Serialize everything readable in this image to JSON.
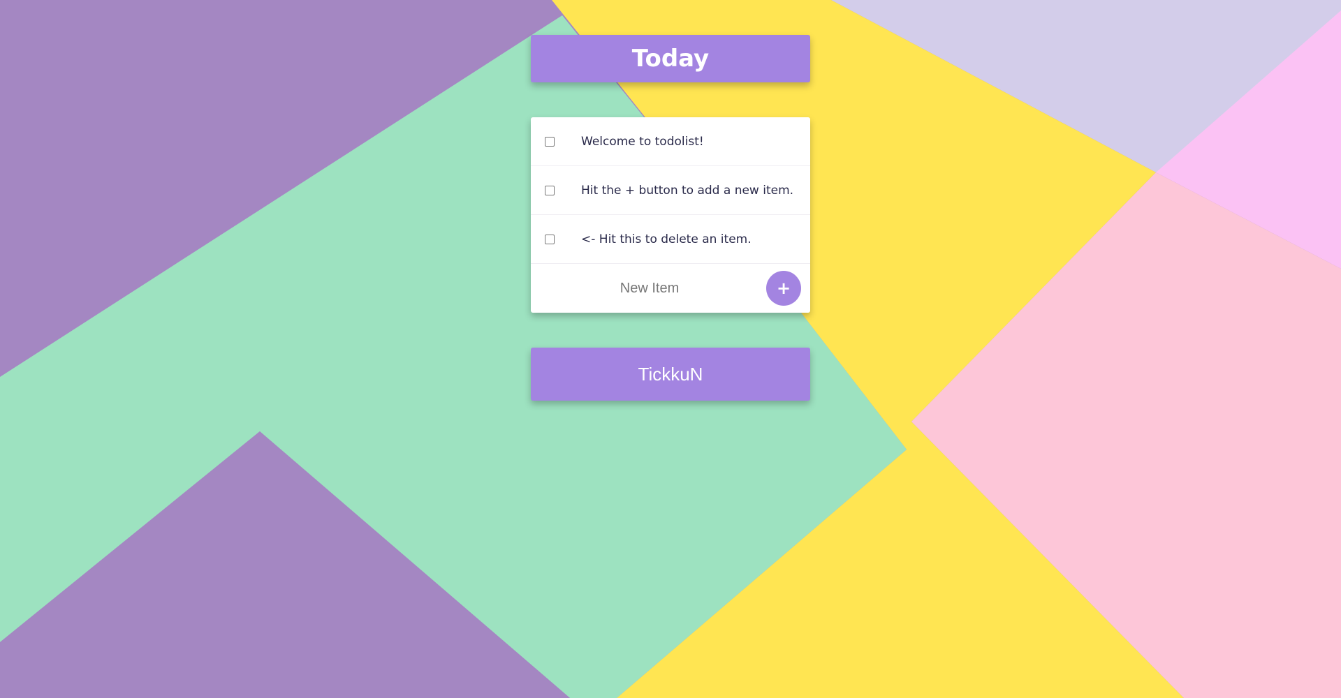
{
  "header": {
    "title": "Today"
  },
  "todo_list": {
    "items": [
      {
        "label": "Welcome to todolist!",
        "checked": false
      },
      {
        "label": "Hit the + button to add a new item.",
        "checked": false
      },
      {
        "label": "<- Hit this to delete an item.",
        "checked": false
      }
    ],
    "new_item": {
      "placeholder": "New Item",
      "value": "",
      "add_label": "+"
    }
  },
  "footer": {
    "text": "TickkuN"
  },
  "colors": {
    "accent": "#a384e1",
    "card": "#ffffff",
    "text": "#2a2a4a",
    "bg_purple": "#a487c2",
    "bg_mint": "#9de2c0",
    "bg_yellow": "#ffe552",
    "bg_lavender": "#d3cdea",
    "bg_pink": "#fdc6d8",
    "bg_magenta": "#fbc2f4"
  },
  "icons": {
    "add": "plus-icon",
    "checkbox": "checkbox-icon"
  }
}
